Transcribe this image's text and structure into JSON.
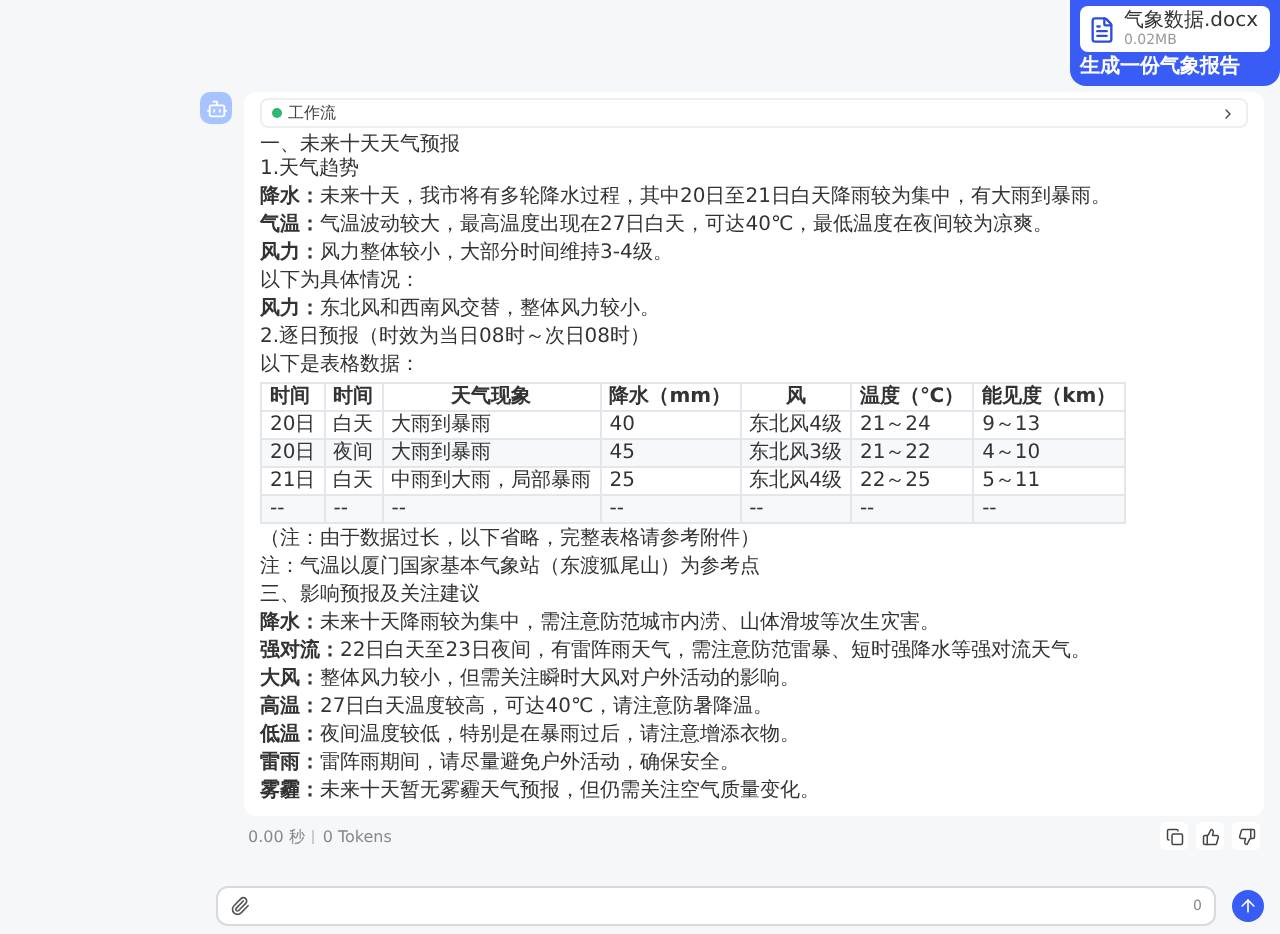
{
  "user_message": {
    "attachment": {
      "name": "气象数据.docx",
      "size": "0.02MB"
    },
    "text": "生成一份气象报告"
  },
  "reply": {
    "workflow": {
      "label": "工作流",
      "expanded": false
    },
    "blocks": [
      {
        "kind": "line",
        "text": "一、未来十天天气预报"
      },
      {
        "kind": "line",
        "text": "1.天气趋势"
      },
      {
        "kind": "paragraph",
        "text": "**降水：**未来十天，我市将有多轮降水过程，其中20日至21日白天降雨较为集中，有大雨到暴雨。"
      },
      {
        "kind": "paragraph",
        "text": "**气温：**气温波动较大，最高温度出现在27日白天，可达40℃，最低温度在夜间较为凉爽。"
      },
      {
        "kind": "paragraph",
        "text": "**风力：**风力整体较小，大部分时间维持3-4级。"
      },
      {
        "kind": "paragraph",
        "text": "以下为具体情况："
      },
      {
        "kind": "paragraph",
        "text": "**风力：**东北风和西南风交替，整体风力较小。"
      },
      {
        "kind": "paragraph",
        "text": "2.逐日预报（时效为当日08时～次日08时）"
      },
      {
        "kind": "paragraph",
        "text": "以下是表格数据："
      },
      {
        "kind": "table",
        "columns": [
          "时间",
          "时间",
          "天气现象",
          "降水（mm）",
          "风",
          "温度（℃）",
          "能见度（km）"
        ],
        "rows": [
          [
            "20日",
            "白天",
            "大雨到暴雨",
            "40",
            "东北风4级",
            "21～24",
            "9～13"
          ],
          [
            "20日",
            "夜间",
            "大雨到暴雨",
            "45",
            "东北风3级",
            "21～22",
            "4～10"
          ],
          [
            "21日",
            "白天",
            "中雨到大雨，局部暴雨",
            "25",
            "东北风4级",
            "22～25",
            "5～11"
          ],
          [
            "--",
            "--",
            "--",
            "--",
            "--",
            "--",
            "--"
          ]
        ]
      },
      {
        "kind": "paragraph",
        "text": "（注：由于数据过长，以下省略，完整表格请参考附件）"
      },
      {
        "kind": "paragraph",
        "text": "注：气温以厦门国家基本气象站（东渡狐尾山）为参考点"
      },
      {
        "kind": "paragraph",
        "text": "三、影响预报及关注建议"
      },
      {
        "kind": "paragraph",
        "text": "**降水：**未来十天降雨较为集中，需注意防范城市内涝、山体滑坡等次生灾害。"
      },
      {
        "kind": "paragraph",
        "text": "**强对流：**22日白天至23日夜间，有雷阵雨天气，需注意防范雷暴、短时强降水等强对流天气。"
      },
      {
        "kind": "paragraph",
        "text": "**大风：**整体风力较小，但需关注瞬时大风对户外活动的影响。"
      },
      {
        "kind": "paragraph",
        "text": "**高温：**27日白天温度较高，可达40℃，请注意防暑降温。"
      },
      {
        "kind": "paragraph",
        "text": "**低温：**夜间温度较低，特别是在暴雨过后，请注意增添衣物。"
      },
      {
        "kind": "paragraph",
        "text": "**雷雨：**雷阵雨期间，请尽量避免户外活动，确保安全。"
      },
      {
        "kind": "paragraph",
        "text": "**雾霾：**未来十天暂无雾霾天气预报，但仍需关注空气质量变化。"
      }
    ],
    "footer": {
      "time": "0.00 秒",
      "tokens": "0 Tokens"
    }
  },
  "input": {
    "counter": "0"
  }
}
